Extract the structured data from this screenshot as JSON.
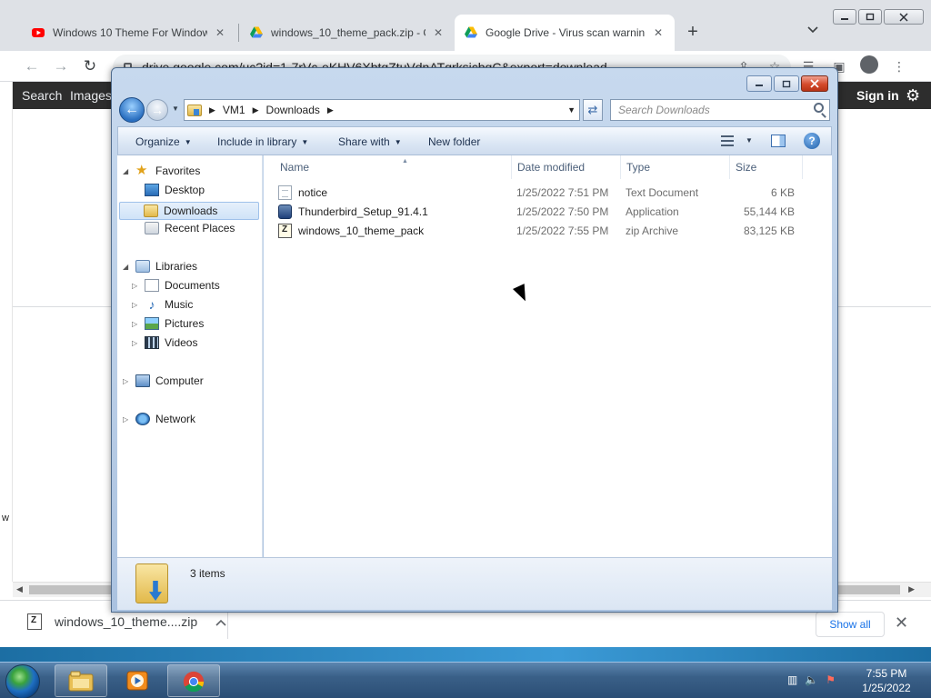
{
  "browser": {
    "tabs": [
      {
        "title": "Windows 10 Theme For Windows",
        "icon": "youtube-icon",
        "close": "✕"
      },
      {
        "title": "windows_10_theme_pack.zip - Go",
        "icon": "google-drive-icon",
        "close": "✕"
      },
      {
        "title": "Google Drive - Virus scan warnin",
        "icon": "google-drive-icon",
        "close": "✕"
      }
    ],
    "new_tab": "+",
    "url": "drive.google.com/uc?id=1-7rVc-eKHV6XbtqZtuVdnATqrksicbqC&export=download",
    "drive_bar": {
      "search": "Search",
      "images": "Images",
      "sign_in": "Sign in"
    }
  },
  "explorer": {
    "breadcrumb": [
      "VM1",
      "Downloads"
    ],
    "search_placeholder": "Search Downloads",
    "toolbar": {
      "organize": "Organize",
      "include_in_library": "Include in library",
      "share_with": "Share with",
      "new_folder": "New folder"
    },
    "nav": {
      "favorites": "Favorites",
      "desktop": "Desktop",
      "downloads": "Downloads",
      "recent_places": "Recent Places",
      "libraries": "Libraries",
      "documents": "Documents",
      "music": "Music",
      "pictures": "Pictures",
      "videos": "Videos",
      "computer": "Computer",
      "network": "Network"
    },
    "columns": {
      "name": "Name",
      "date_modified": "Date modified",
      "type": "Type",
      "size": "Size"
    },
    "files": [
      {
        "name": "notice",
        "date": "1/25/2022 7:51 PM",
        "type": "Text Document",
        "size": "6 KB",
        "icon": "text-file-icon"
      },
      {
        "name": "Thunderbird_Setup_91.4.1",
        "date": "1/25/2022 7:50 PM",
        "type": "Application",
        "size": "55,144 KB",
        "icon": "application-icon"
      },
      {
        "name": "windows_10_theme_pack",
        "date": "1/25/2022 7:55 PM",
        "type": "zip Archive",
        "size": "83,125 KB",
        "icon": "zip-archive-icon"
      }
    ],
    "status": {
      "item_count": "3 items"
    }
  },
  "downloads_shelf": {
    "file": "windows_10_theme....zip",
    "show_all": "Show all"
  },
  "taskbar": {
    "time": "7:55 PM",
    "date": "1/25/2022"
  },
  "colors": {
    "drive_bar": "#2d2d2d",
    "tab_strip": "#dee1e6",
    "explorer_frame": "#b9cde6",
    "show_all_text": "#1a73e8"
  }
}
